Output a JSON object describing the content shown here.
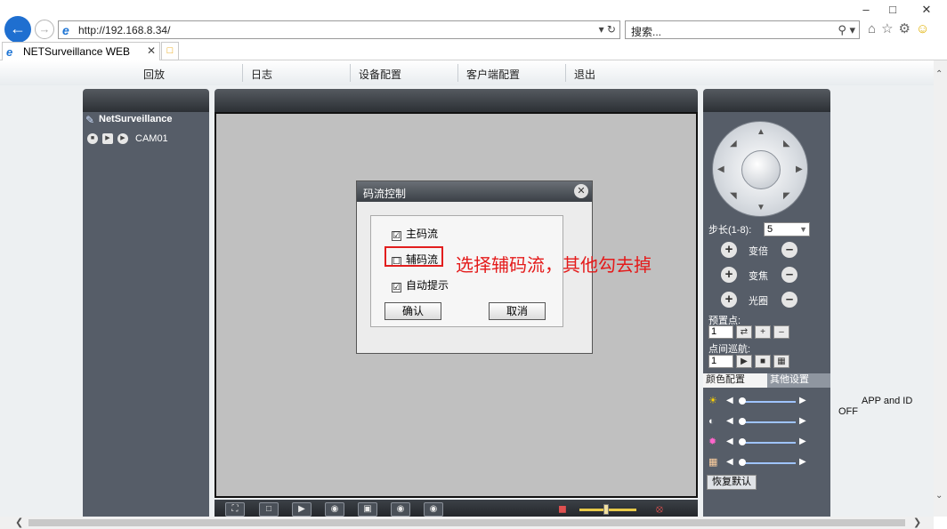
{
  "browser": {
    "url": "http://192.168.8.34/",
    "search_placeholder": "搜索...",
    "tab_title": "NETSurveillance WEB"
  },
  "menu": {
    "items": [
      "回放",
      "日志",
      "设备配置",
      "客户端配置",
      "退出"
    ]
  },
  "device": {
    "name": "NetSurveillance",
    "camera": "CAM01"
  },
  "dialog": {
    "title": "码流控制",
    "options": [
      {
        "label": "主码流",
        "checked": true,
        "mark": "☑"
      },
      {
        "label": "辅码流",
        "checked": false,
        "mark": "☐"
      },
      {
        "label": "自动提示",
        "checked": true,
        "mark": "☑"
      }
    ],
    "ok_label": "确认",
    "cancel_label": "取消"
  },
  "annotation": "选择辅码流，其他勾去掉",
  "ptz": {
    "step_label": "步长(1-8):",
    "step_value": "5",
    "zoom_label": "变倍",
    "focus_label": "变焦",
    "iris_label": "光圈",
    "preset_label": "预置点:",
    "preset_value": "1",
    "tour_label": "点间巡航:",
    "tour_value": "1"
  },
  "color": {
    "tab_color": "颜色配置",
    "tab_other": "其他设置",
    "rows": [
      "brightness-icon",
      "contrast-icon",
      "saturation-icon",
      "hue-icon"
    ],
    "restore_label": "恢复默认"
  },
  "overlay": {
    "line1": "APP and ID",
    "line2": "OFF"
  },
  "colors": {
    "accent": "#1f6fd0",
    "annotation": "#e41a1a",
    "panel": "#565d68"
  }
}
